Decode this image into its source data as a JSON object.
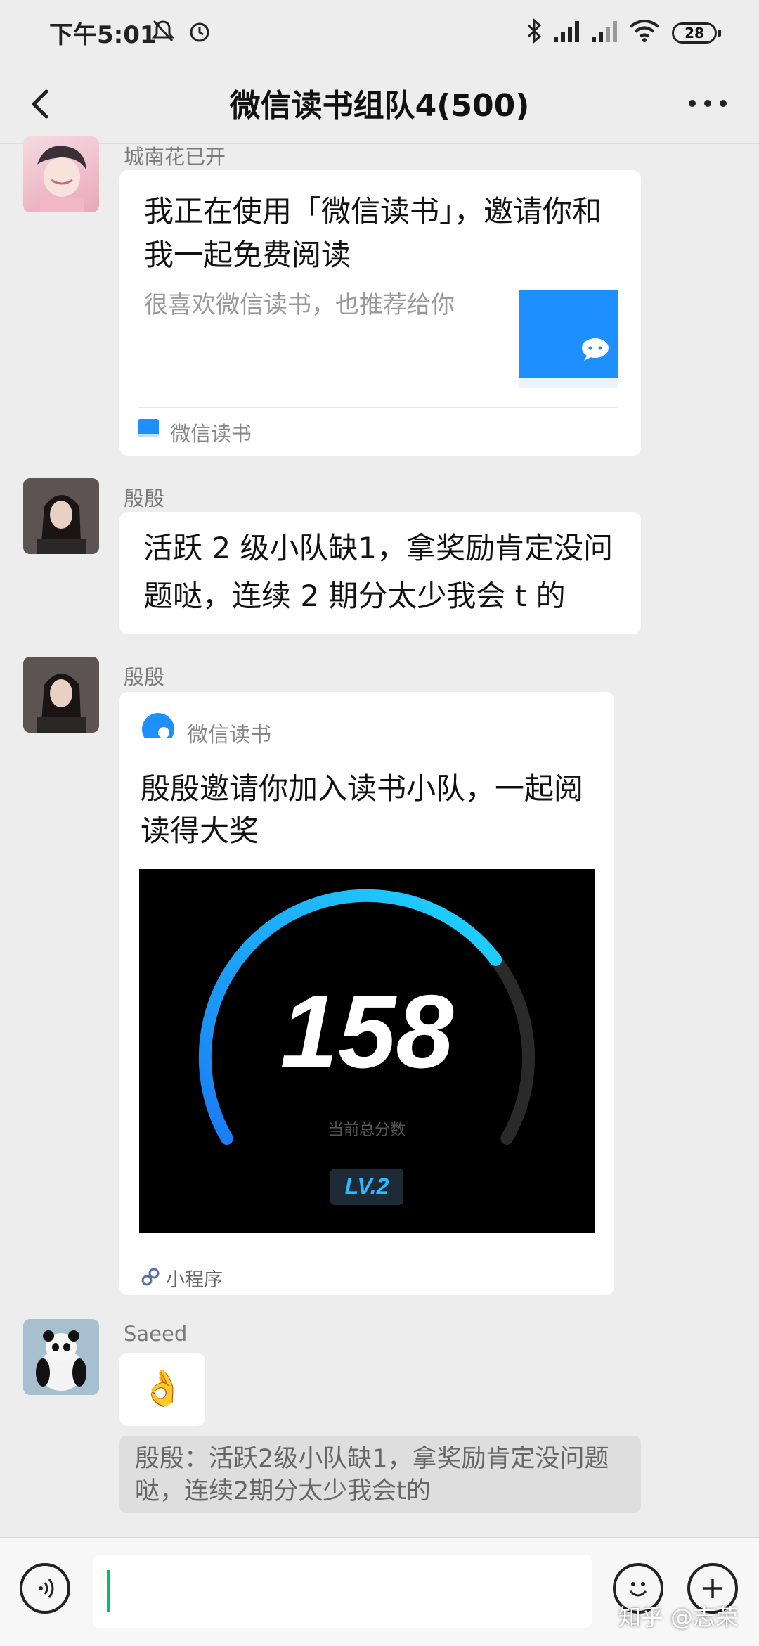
{
  "status_bar": {
    "time": "下午5:01",
    "battery": "28"
  },
  "header": {
    "title": "微信读书组队4(500)"
  },
  "messages": [
    {
      "sender": "城南花已开",
      "card": {
        "title": "我正在使用「微信读书」，邀请你和我一起免费阅读",
        "description": "很喜欢微信读书，也推荐给你",
        "source": "微信读书"
      }
    },
    {
      "sender": "殷殷",
      "text": "活跃 2 级小队缺1，拿奖励肯定没问题哒，连续 2 期分太少我会 t 的"
    },
    {
      "sender": "殷殷",
      "card": {
        "app_name": "微信读书",
        "title": "殷殷邀请你加入读书小队，一起阅读得大奖",
        "score": "158",
        "score_label": "当前总分数",
        "score_level": 0.72,
        "level": "LV.2",
        "type": "小程序"
      }
    },
    {
      "sender": "Saeed",
      "emoji": "👌",
      "quote": "殷殷：活跃2级小队缺1，拿奖励肯定没问题哒，连续2期分太少我会t的"
    }
  ],
  "watermark": "知乎 @志荣",
  "colors": {
    "accent": "#07c160",
    "link_blue": "#1e88ff",
    "gauge_start": "#1a7cf5",
    "gauge_end": "#1fd6ff"
  },
  "icons": [
    "back-icon",
    "more-icon",
    "voice-icon",
    "emoji-icon",
    "add-icon",
    "mini-program-icon"
  ]
}
